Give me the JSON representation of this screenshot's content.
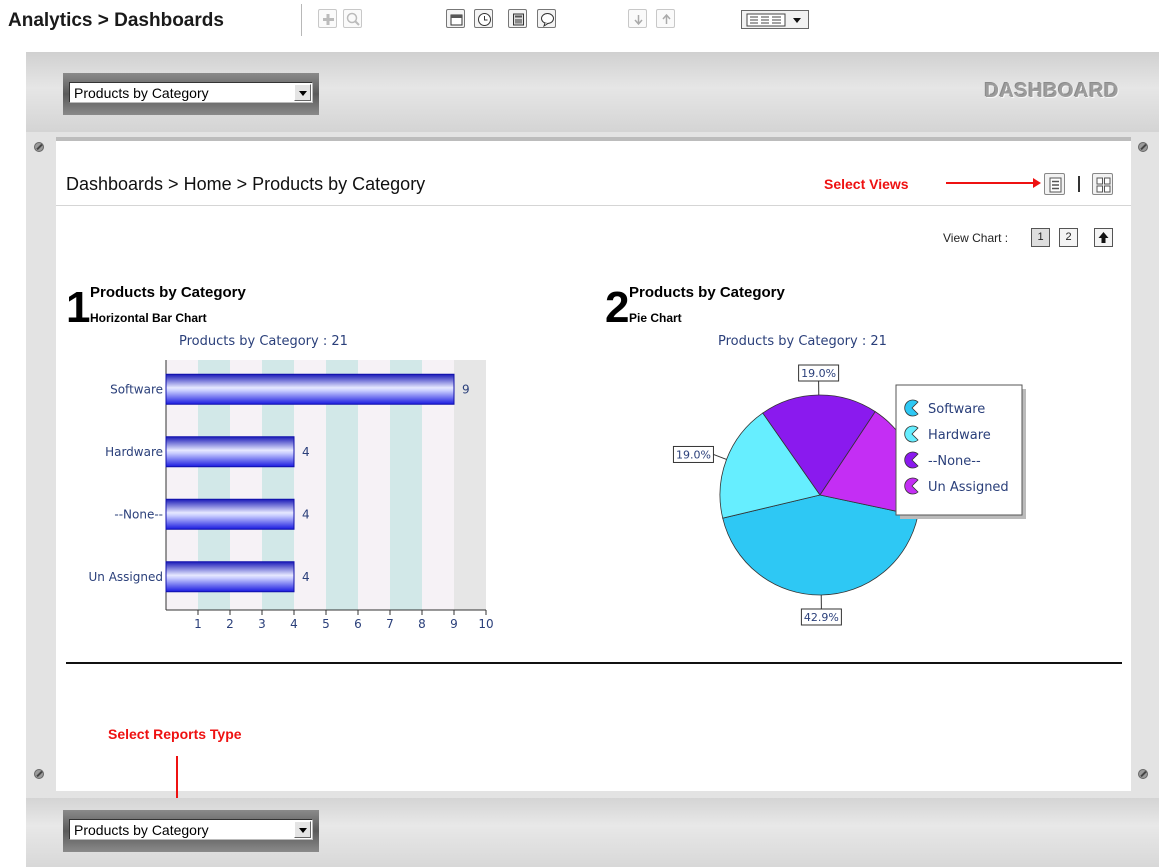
{
  "app": {
    "title": "Analytics > Dashboards"
  },
  "toolbar": {
    "icons": [
      "add-icon",
      "search-icon",
      "calendar-icon",
      "clock-icon",
      "calculator-icon",
      "comment-icon",
      "move-down-icon",
      "move-up-icon",
      "columns-menu-icon"
    ]
  },
  "header": {
    "report_select_value": "Products by Category",
    "wordmark": "DASHBOARD"
  },
  "page": {
    "breadcrumb": "Dashboards > Home > Products by Category",
    "select_views_label": "Select Views",
    "view_chart_label": "View Chart :",
    "view_chart_pages": [
      "1",
      "2"
    ]
  },
  "charts": [
    {
      "number": "1",
      "title": "Products by Category",
      "subtitle": "Horizontal Bar Chart",
      "caption": "Products by Category : 21"
    },
    {
      "number": "2",
      "title": "Products by Category",
      "subtitle": "Pie Chart",
      "caption": "Products by Category : 21"
    }
  ],
  "chart_data": [
    {
      "type": "bar",
      "orientation": "horizontal",
      "title": "Products by Category : 21",
      "categories": [
        "Software",
        "Hardware",
        "--None--",
        "Un Assigned"
      ],
      "values": [
        9,
        4,
        4,
        4
      ],
      "xlim": [
        0,
        10
      ],
      "x_ticks": [
        "1",
        "2",
        "3",
        "4",
        "5",
        "6",
        "7",
        "8",
        "9",
        "10"
      ],
      "bar_color": "#1a1aee"
    },
    {
      "type": "pie",
      "title": "Products by Category : 21",
      "categories": [
        "Software",
        "Hardware",
        "--None--",
        "Un Assigned"
      ],
      "values": [
        42.9,
        19.0,
        19.0,
        19.0
      ],
      "labels": [
        "42.9%",
        "19.0%",
        "19.0%",
        "19.0%"
      ],
      "colors": [
        "#2ec8f4",
        "#66eeff",
        "#8a1aee",
        "#c42ef4"
      ],
      "legend": "right"
    }
  ],
  "footer": {
    "select_reports_label": "Select Reports Type",
    "report_select_value": "Products by Category"
  },
  "colors": {
    "annotation": "#ee1111",
    "caption": "#2a3f7a"
  }
}
